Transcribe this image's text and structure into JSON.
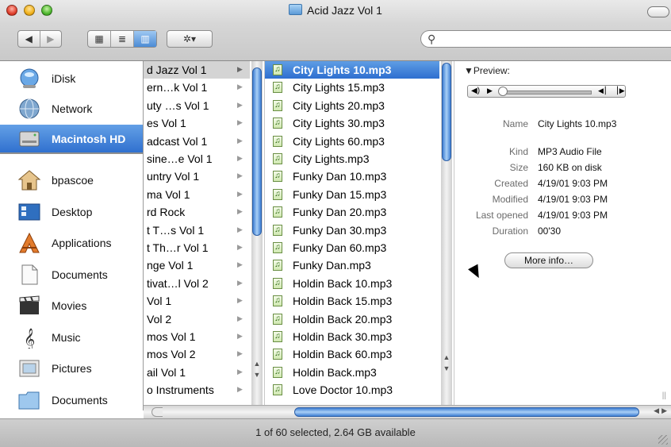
{
  "window": {
    "title": "Acid Jazz Vol 1"
  },
  "toolbar": {
    "back_label": "◀",
    "forward_label": "▶",
    "view_icon_label": "▦",
    "view_list_label": "≣",
    "view_column_label": "▥",
    "action_label": "✲▾",
    "search_placeholder": ""
  },
  "sidebar": {
    "items": [
      {
        "label": "iDisk",
        "icon": "idisk-icon",
        "selected": false
      },
      {
        "label": "Network",
        "icon": "network-globe-icon",
        "selected": false
      },
      {
        "label": "Macintosh HD",
        "icon": "hard-drive-icon",
        "selected": true
      },
      {
        "label": "bpascoe",
        "icon": "home-icon",
        "selected": false
      },
      {
        "label": "Desktop",
        "icon": "desktop-icon",
        "selected": false
      },
      {
        "label": "Applications",
        "icon": "applications-icon",
        "selected": false
      },
      {
        "label": "Documents",
        "icon": "document-icon",
        "selected": false
      },
      {
        "label": "Movies",
        "icon": "movies-clapper-icon",
        "selected": false
      },
      {
        "label": "Music",
        "icon": "music-clef-icon",
        "selected": false
      },
      {
        "label": "Pictures",
        "icon": "pictures-icon",
        "selected": false
      },
      {
        "label": "Documents",
        "icon": "folder-icon",
        "selected": false
      }
    ]
  },
  "column1": {
    "items": [
      "d Jazz Vol 1",
      "ern…k Vol 1",
      "uty …s Vol 1",
      "es Vol 1",
      "adcast Vol 1",
      "sine…e Vol 1",
      "untry Vol 1",
      "ma Vol 1",
      "rd Rock",
      "t T…s Vol 1",
      "t Th…r Vol 1",
      "nge Vol 1",
      "tivat…l Vol 2",
      "Vol 1",
      "Vol 2",
      "mos Vol 1",
      "mos Vol 2",
      "ail Vol 1",
      "o Instruments"
    ],
    "selected_index": 0
  },
  "column2": {
    "items": [
      "City Lights 10.mp3",
      "City Lights 15.mp3",
      "City Lights 20.mp3",
      "City Lights 30.mp3",
      "City Lights 60.mp3",
      "City Lights.mp3",
      "Funky Dan 10.mp3",
      "Funky Dan 15.mp3",
      "Funky Dan 20.mp3",
      "Funky Dan 30.mp3",
      "Funky Dan 60.mp3",
      "Funky Dan.mp3",
      "Holdin Back 10.mp3",
      "Holdin Back 15.mp3",
      "Holdin Back 20.mp3",
      "Holdin Back 30.mp3",
      "Holdin Back 60.mp3",
      "Holdin Back.mp3",
      "Love Doctor 10.mp3"
    ],
    "selected_index": 0
  },
  "preview": {
    "heading": "▼Preview:",
    "player": {
      "volume_glyph": "◀)",
      "play_glyph": "▶",
      "step_glyph": "◀▏▕▶",
      "position": 0.0
    },
    "fields": [
      {
        "key": "Name",
        "value": "City Lights 10.mp3"
      },
      {
        "key": "Kind",
        "value": "MP3 Audio File"
      },
      {
        "key": "Size",
        "value": "160 KB on disk"
      },
      {
        "key": "Created",
        "value": "4/19/01 9:03 PM"
      },
      {
        "key": "Modified",
        "value": "4/19/01 9:03 PM"
      },
      {
        "key": "Last opened",
        "value": "4/19/01 9:03 PM"
      },
      {
        "key": "Duration",
        "value": "00'30"
      }
    ],
    "more_info_label": "More info…"
  },
  "status": {
    "text": "1 of 60 selected, 2.64 GB available"
  },
  "colors": {
    "selection_blue": "#3a7bd5",
    "metal": "#d0d0d0"
  }
}
